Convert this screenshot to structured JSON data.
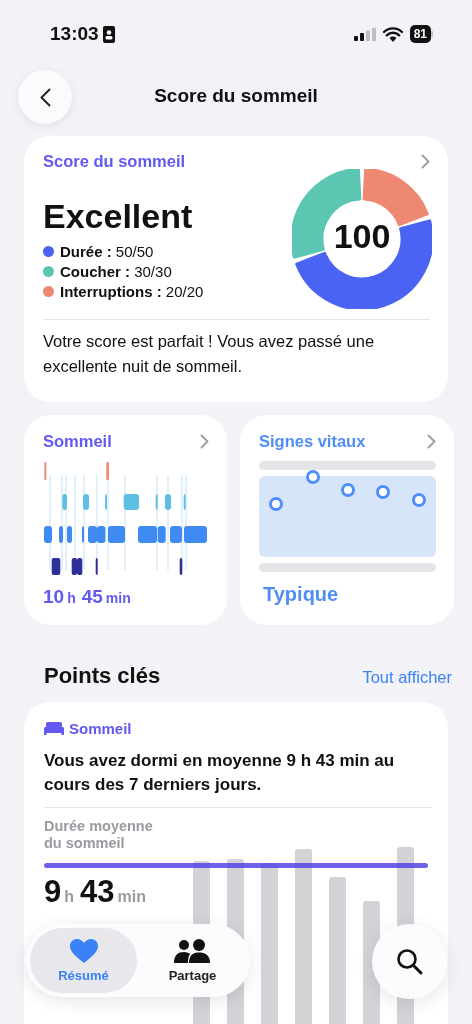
{
  "status_bar": {
    "time": "13:03",
    "battery": "81"
  },
  "header": {
    "title": "Score du sommeil"
  },
  "score_card": {
    "title": "Score du sommeil",
    "rating": "Excellent",
    "score": "100",
    "legend": [
      {
        "text": "**Durée :** 50/50",
        "color": "#4a63f2"
      },
      {
        "text": "**Coucher :** 30/30",
        "color": "#5cc6b3"
      },
      {
        "text": "**Interruptions :** 20/20",
        "color": "#ef8872"
      }
    ],
    "chart_data": {
      "type": "donut",
      "values": [
        50,
        30,
        20
      ]
    },
    "description": "Votre score est parfait ! Vous avez passé une excellente nuit de sommeil."
  },
  "sleep_card": {
    "title": "Sommeil",
    "duration": [
      {
        "value": "10",
        "unit": "h"
      },
      {
        "value": "45",
        "unit": "min"
      }
    ]
  },
  "vitals_card": {
    "title": "Signes vitaux",
    "status": "Typique"
  },
  "highlights": {
    "title": "Points clés",
    "link": "Tout afficher",
    "card": {
      "category": "Sommeil",
      "sentence": "Vous avez dormi en moyenne 9 h 43 min au cours des 7 derniers jours.",
      "label": "Durée moyenne du sommeil",
      "value": [
        {
          "value": "9",
          "unit": "h"
        },
        {
          "value": "43",
          "unit": "min"
        }
      ]
    }
  },
  "tab_bar": {
    "tabs": [
      {
        "label": "Résumé",
        "kind": "heart",
        "selected": true
      },
      {
        "label": "Partage",
        "kind": "people",
        "selected": false
      }
    ]
  }
}
